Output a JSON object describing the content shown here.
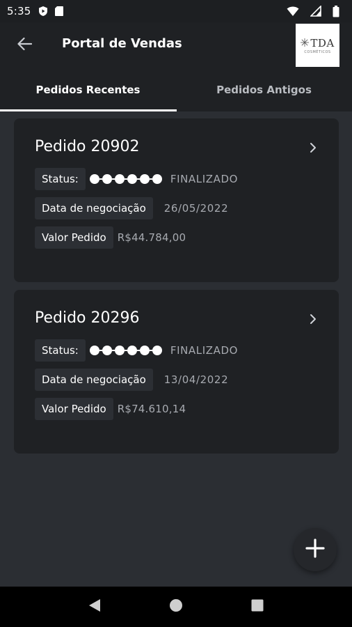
{
  "status_bar": {
    "time": "5:35",
    "left_icons": [
      "play-shield-icon",
      "sd-card-icon"
    ],
    "right_icons": [
      "wifi-icon",
      "cell-signal-icon",
      "battery-icon"
    ]
  },
  "app_bar": {
    "back_icon": "arrow-left-icon",
    "title": "Portal de Vendas",
    "logo_text": "TDA",
    "logo_sub": "COSMÉTICOS"
  },
  "tabs": [
    {
      "label": "Pedidos Recentes",
      "active": true
    },
    {
      "label": "Pedidos Antigos",
      "active": false
    }
  ],
  "orders": [
    {
      "title": "Pedido 20902",
      "status_label": "Status:",
      "status_steps_completed": 6,
      "status_steps_total": 6,
      "status_value": "FINALIZADO",
      "date_label": "Data de negociação",
      "date_value": "26/05/2022",
      "amount_label": "Valor Pedido",
      "amount_value": "R$44.784,00"
    },
    {
      "title": "Pedido 20296",
      "status_label": "Status:",
      "status_steps_completed": 6,
      "status_steps_total": 6,
      "status_value": "FINALIZADO",
      "date_label": "Data de negociação",
      "date_value": "13/04/2022",
      "amount_label": "Valor Pedido",
      "amount_value": "R$74.610,14"
    }
  ],
  "fab": {
    "icon": "plus-icon"
  },
  "nav_bar": {
    "icons": [
      "back-triangle-icon",
      "home-circle-icon",
      "recents-square-icon"
    ]
  },
  "colors": {
    "background": "#2b2e33",
    "surface": "#1f2124",
    "label_bg": "#2c2f34",
    "muted_text": "#a7aab0",
    "accent": "#ffffff"
  }
}
